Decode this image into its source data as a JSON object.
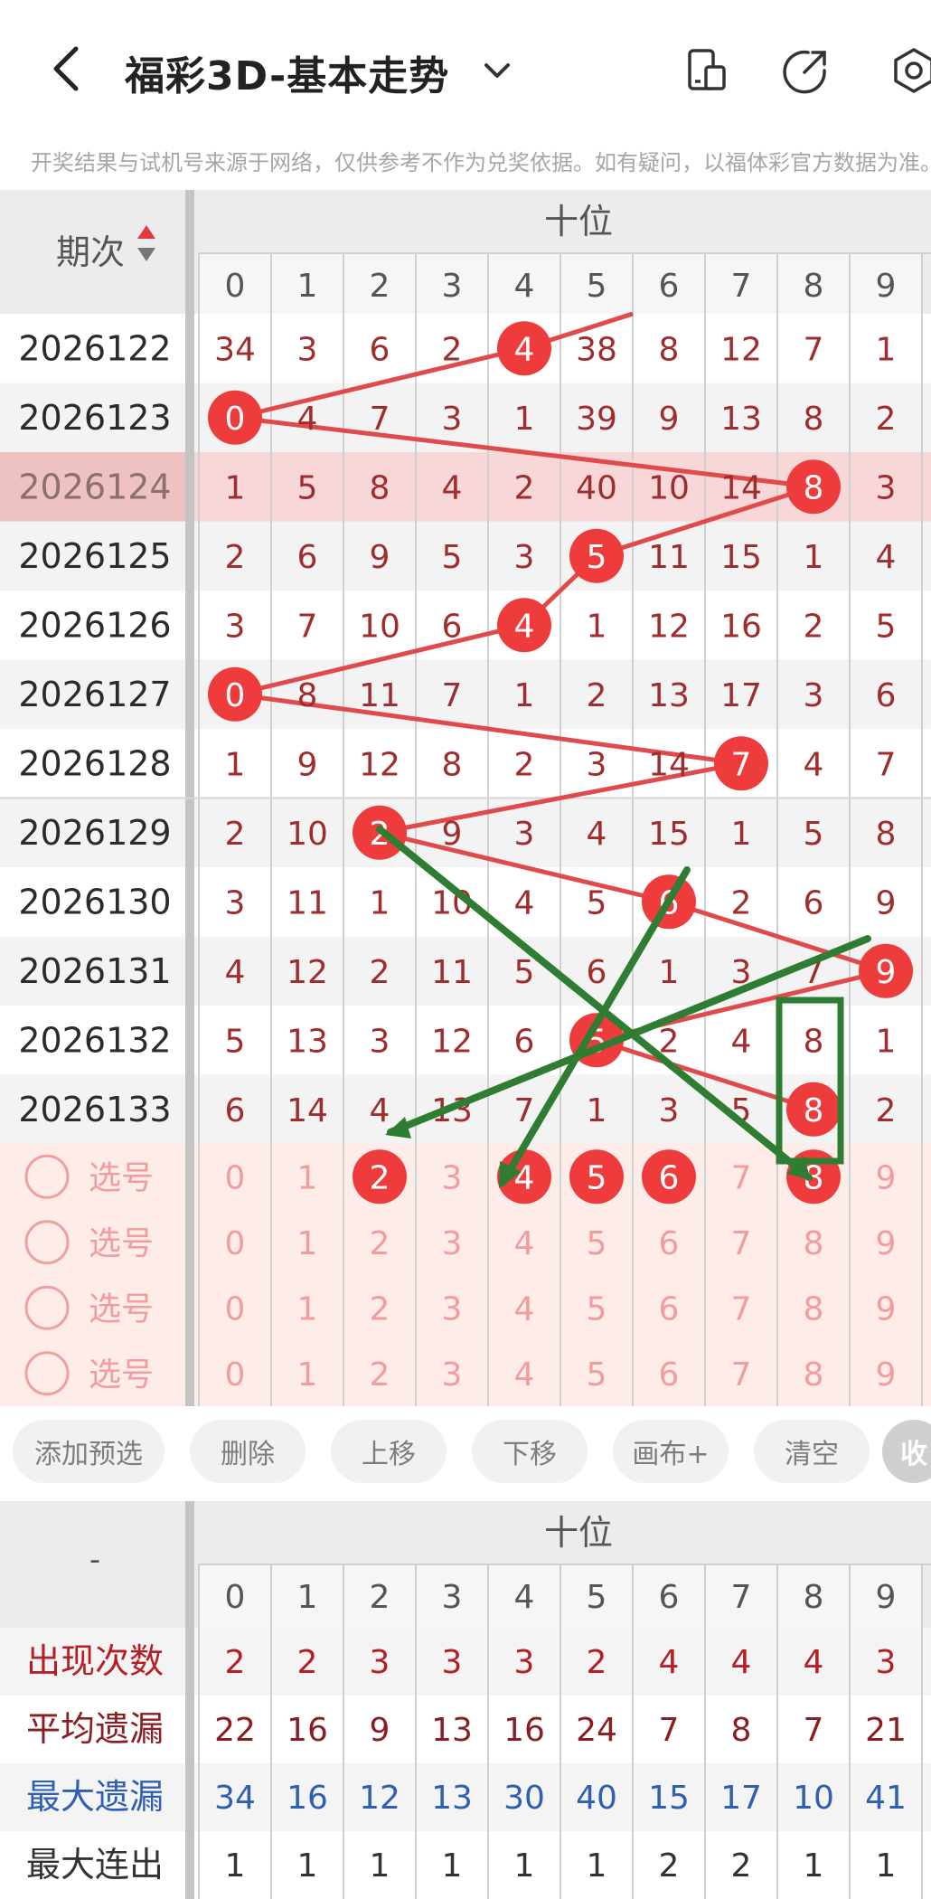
{
  "header": {
    "title": "福彩3D-基本走势",
    "notice": "开奖结果与试机号来源于网络，仅供参考不作为兑奖依据。如有疑问，以福体彩官方数据为准。"
  },
  "table": {
    "period_header": "期次",
    "group_header": "十位",
    "digits": [
      "0",
      "1",
      "2",
      "3",
      "4",
      "5",
      "6",
      "7",
      "8",
      "9"
    ],
    "rows": [
      {
        "period": "2026122",
        "cells": [
          "34",
          "3",
          "6",
          "2",
          "4",
          "38",
          "8",
          "12",
          "7",
          "1"
        ],
        "hit": 4
      },
      {
        "period": "2026123",
        "cells": [
          "0",
          "4",
          "7",
          "3",
          "1",
          "39",
          "9",
          "13",
          "8",
          "2"
        ],
        "hit": 0
      },
      {
        "period": "2026124",
        "cells": [
          "1",
          "5",
          "8",
          "4",
          "2",
          "40",
          "10",
          "14",
          "8",
          "3"
        ],
        "hit": 8,
        "highlight": true
      },
      {
        "period": "2026125",
        "cells": [
          "2",
          "6",
          "9",
          "5",
          "3",
          "5",
          "11",
          "15",
          "1",
          "4"
        ],
        "hit": 5
      },
      {
        "period": "2026126",
        "cells": [
          "3",
          "7",
          "10",
          "6",
          "4",
          "1",
          "12",
          "16",
          "2",
          "5"
        ],
        "hit": 4
      },
      {
        "period": "2026127",
        "cells": [
          "0",
          "8",
          "11",
          "7",
          "1",
          "2",
          "13",
          "17",
          "3",
          "6"
        ],
        "hit": 0
      },
      {
        "period": "2026128",
        "cells": [
          "1",
          "9",
          "12",
          "8",
          "2",
          "3",
          "14",
          "7",
          "4",
          "7"
        ],
        "hit": 7
      },
      {
        "period": "2026129",
        "cells": [
          "2",
          "10",
          "2",
          "9",
          "3",
          "4",
          "15",
          "1",
          "5",
          "8"
        ],
        "hit": 2
      },
      {
        "period": "2026130",
        "cells": [
          "3",
          "11",
          "1",
          "10",
          "4",
          "5",
          "6",
          "2",
          "6",
          "9"
        ],
        "hit": 6
      },
      {
        "period": "2026131",
        "cells": [
          "4",
          "12",
          "2",
          "11",
          "5",
          "6",
          "1",
          "3",
          "7",
          "9"
        ],
        "hit": 9
      },
      {
        "period": "2026132",
        "cells": [
          "5",
          "13",
          "3",
          "12",
          "6",
          "5",
          "2",
          "4",
          "8",
          "1"
        ],
        "hit": 5
      },
      {
        "period": "2026133",
        "cells": [
          "6",
          "14",
          "4",
          "13",
          "7",
          "1",
          "3",
          "5",
          "8",
          "2"
        ],
        "hit": 8
      }
    ],
    "select_label": "选号",
    "select_rows": [
      {
        "selected": [
          2,
          4,
          5,
          6,
          8
        ]
      },
      {
        "selected": []
      },
      {
        "selected": []
      },
      {
        "selected": []
      }
    ]
  },
  "buttons": [
    "添加预选",
    "删除",
    "上移",
    "下移",
    "画布+",
    "清空",
    "收"
  ],
  "stats": {
    "corner": "-",
    "group_header": "十位",
    "rows": [
      {
        "label": "出现次数",
        "color": "#b51f24",
        "values": [
          "2",
          "2",
          "3",
          "3",
          "3",
          "2",
          "4",
          "4",
          "4",
          "3"
        ]
      },
      {
        "label": "平均遗漏",
        "color": "#8a1e22",
        "values": [
          "22",
          "16",
          "9",
          "13",
          "16",
          "24",
          "7",
          "8",
          "7",
          "21"
        ]
      },
      {
        "label": "最大遗漏",
        "color": "#2f5fb3",
        "values": [
          "34",
          "16",
          "12",
          "13",
          "30",
          "40",
          "15",
          "17",
          "10",
          "41"
        ]
      },
      {
        "label": "最大连出",
        "color": "#333333",
        "values": [
          "1",
          "1",
          "1",
          "1",
          "1",
          "1",
          "2",
          "2",
          "1",
          "1"
        ]
      }
    ]
  },
  "colors": {
    "hit_ball": "#ee3b3b",
    "miss_text": "#a02d2d",
    "trend_line": "#e04a4a",
    "annotation": "#2e7d32",
    "select_bg": "#fdece7",
    "select_text": "#f29d9d",
    "highlight_row": "#f7d7d7"
  }
}
